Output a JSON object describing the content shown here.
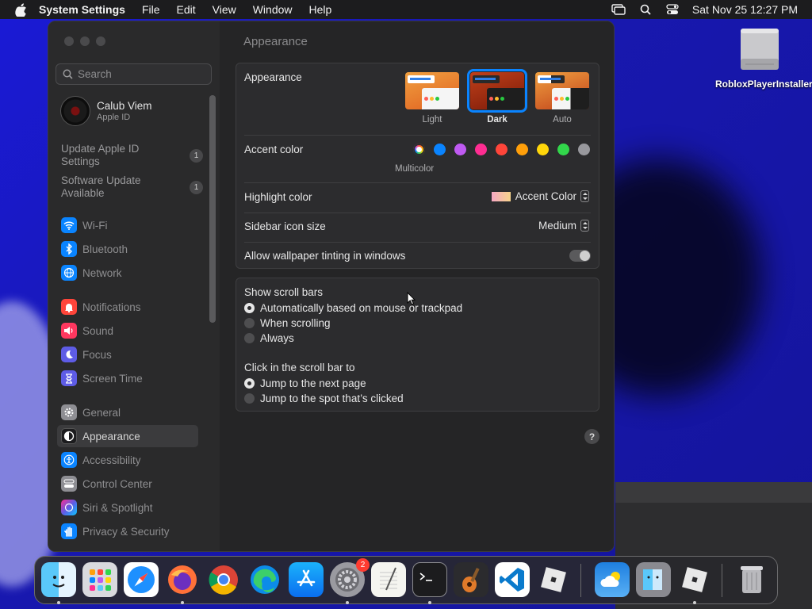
{
  "menubar": {
    "app_name": "System Settings",
    "menus": [
      "File",
      "Edit",
      "View",
      "Window",
      "Help"
    ],
    "clock": "Sat Nov 25  12:27 PM"
  },
  "window": {
    "search_placeholder": "Search",
    "user": {
      "name": "Calub Viem",
      "subtitle": "Apple ID"
    },
    "notices": [
      {
        "label": "Update Apple ID Settings",
        "badge": "1"
      },
      {
        "label": "Software Update Available",
        "badge": "1"
      }
    ],
    "sidebar_groups": [
      [
        {
          "label": "Wi-Fi",
          "icon": "wifi-icon",
          "color": "#0a84ff"
        },
        {
          "label": "Bluetooth",
          "icon": "bluetooth-icon",
          "color": "#0a84ff"
        },
        {
          "label": "Network",
          "icon": "globe-icon",
          "color": "#0a84ff"
        }
      ],
      [
        {
          "label": "Notifications",
          "icon": "bell-icon",
          "color": "#ff453a"
        },
        {
          "label": "Sound",
          "icon": "speaker-icon",
          "color": "#ff375f"
        },
        {
          "label": "Focus",
          "icon": "moon-icon",
          "color": "#5e5ce6"
        },
        {
          "label": "Screen Time",
          "icon": "hourglass-icon",
          "color": "#5e5ce6"
        }
      ],
      [
        {
          "label": "General",
          "icon": "gear-icon",
          "color": "#8e8e93"
        },
        {
          "label": "Appearance",
          "icon": "appearance-icon",
          "color": "#1c1c1e",
          "selected": true
        },
        {
          "label": "Accessibility",
          "icon": "accessibility-icon",
          "color": "#0a84ff"
        },
        {
          "label": "Control Center",
          "icon": "control-center-icon",
          "color": "#8e8e93"
        },
        {
          "label": "Siri & Spotlight",
          "icon": "siri-icon",
          "color": "#bf5af2"
        },
        {
          "label": "Privacy & Security",
          "icon": "hand-icon",
          "color": "#0a84ff"
        }
      ]
    ],
    "page_title": "Appearance",
    "appearance": {
      "label": "Appearance",
      "options": [
        {
          "label": "Light",
          "selected": false
        },
        {
          "label": "Dark",
          "selected": true
        },
        {
          "label": "Auto",
          "selected": false
        }
      ]
    },
    "accent": {
      "label": "Accent color",
      "selected_label": "Multicolor",
      "colors": [
        "#0a84ff",
        "#bf5af2",
        "#ff2d92",
        "#ff453a",
        "#ff9f0a",
        "#ffd60a",
        "#32d74b",
        "#98989d"
      ]
    },
    "highlight": {
      "label": "Highlight color",
      "value": "Accent Color"
    },
    "sidebar_icon_size": {
      "label": "Sidebar icon size",
      "value": "Medium"
    },
    "wallpaper_tinting": {
      "label": "Allow wallpaper tinting in windows",
      "on": false
    },
    "scroll_bars": {
      "label": "Show scroll bars",
      "options": [
        {
          "label": "Automatically based on mouse or trackpad",
          "selected": true
        },
        {
          "label": "When scrolling",
          "selected": false
        },
        {
          "label": "Always",
          "selected": false
        }
      ]
    },
    "click_scroll": {
      "label": "Click in the scroll bar to",
      "options": [
        {
          "label": "Jump to the next page",
          "selected": true
        },
        {
          "label": "Jump to the spot that’s clicked",
          "selected": false
        }
      ]
    },
    "help": "?"
  },
  "desktop_icon": {
    "label": "RobloxPlayerInstaller"
  },
  "dock": {
    "apps": [
      "Finder",
      "Launchpad",
      "Safari",
      "Firefox",
      "Chrome",
      "Edge",
      "App Store",
      "System Settings",
      "TextEdit",
      "Terminal",
      "GarageBand",
      "VS Code",
      "Roblox",
      "Weather",
      "Migration Assistant",
      "Roblox Player",
      "Trash"
    ],
    "settings_badge": "2"
  }
}
